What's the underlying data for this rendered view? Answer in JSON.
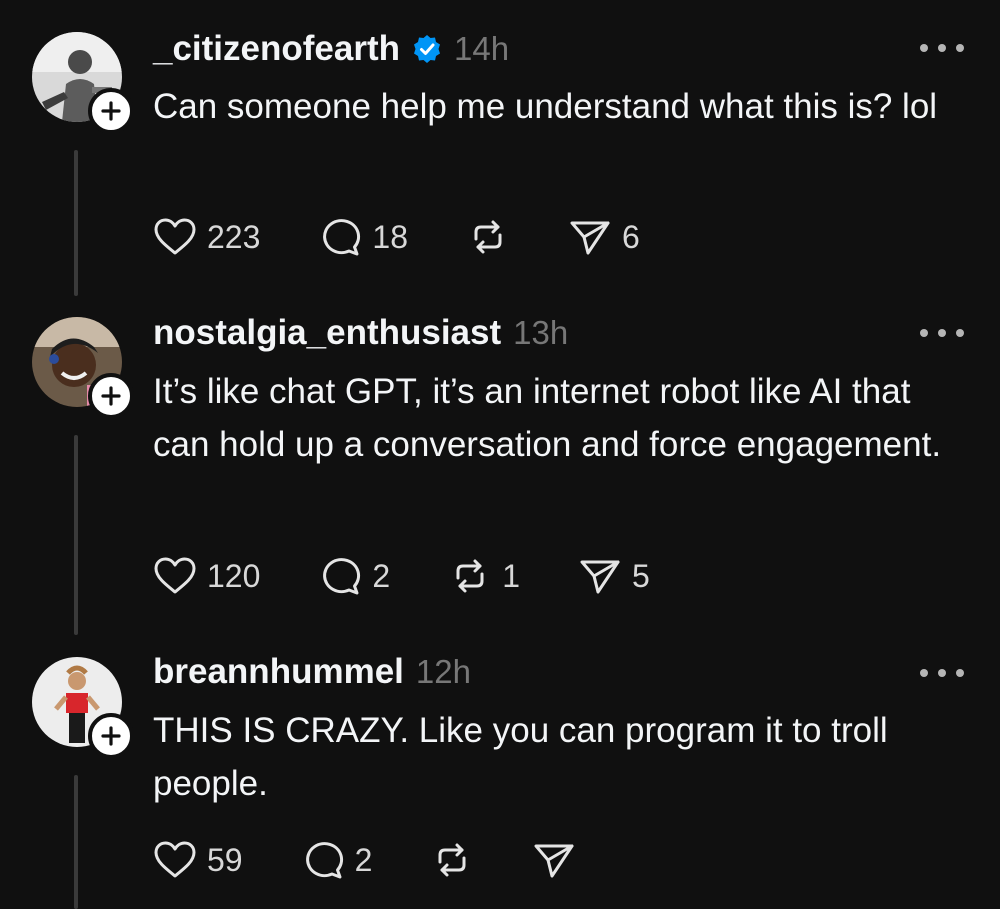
{
  "colors": {
    "background": "#101010",
    "text_primary": "#f3f5f7",
    "text_secondary": "#777777",
    "verified_blue": "#0095f6",
    "thread_line": "#3a3a3a"
  },
  "replies": [
    {
      "username": "_citizenofearth",
      "verified": true,
      "timestamp": "14h",
      "text": "Can someone help me understand what this is? lol",
      "likes": "223",
      "comments": "18",
      "reposts": "",
      "shares": "6"
    },
    {
      "username": "nostalgia_enthusiast",
      "verified": false,
      "timestamp": "13h",
      "text": "It’s like chat GPT, it’s an internet robot like AI that can hold up a conversation and force engagement.",
      "likes": "120",
      "comments": "2",
      "reposts": "1",
      "shares": "5"
    },
    {
      "username": "breannhummel",
      "verified": false,
      "timestamp": "12h",
      "text": "THIS IS CRAZY. Like you can program it to troll people.",
      "likes": "59",
      "comments": "2",
      "reposts": "",
      "shares": ""
    }
  ],
  "icons": {
    "like": "heart-icon",
    "comment": "comment-bubble-icon",
    "repost": "repost-icon",
    "share": "send-icon",
    "more": "more-dots-icon",
    "follow": "plus-icon",
    "verified": "verified-badge-icon"
  }
}
